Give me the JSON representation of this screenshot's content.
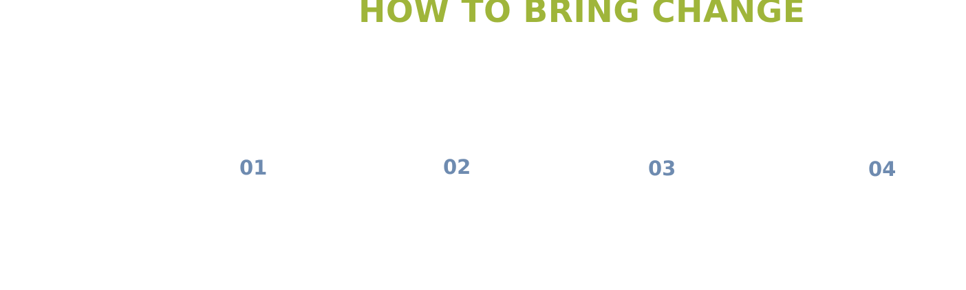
{
  "title": "HOW TO BRING CHANGE",
  "colors": {
    "title": "#9fb53a",
    "step_number": "#6e8bb0",
    "background": "#ffffff"
  },
  "steps": [
    {
      "number": "01"
    },
    {
      "number": "02"
    },
    {
      "number": "03"
    },
    {
      "number": "04"
    }
  ]
}
